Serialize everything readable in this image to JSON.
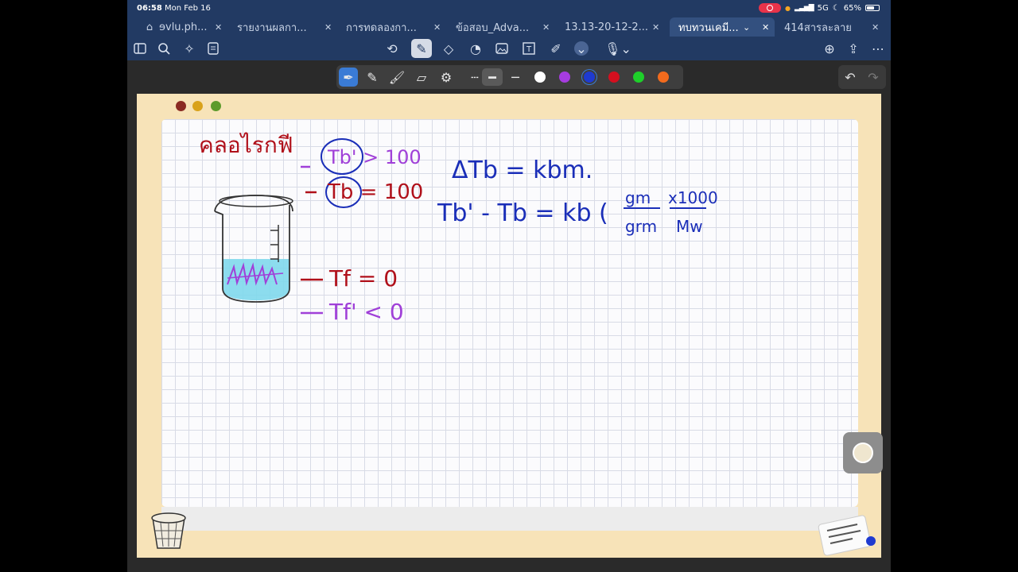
{
  "status_bar": {
    "time": "06:58",
    "date": "Mon Feb 16",
    "network": "5G",
    "battery": "65%"
  },
  "tabs": [
    {
      "label": "ɘvlu.ph...",
      "active": false
    },
    {
      "label": "รายงานผลกา...",
      "active": false
    },
    {
      "label": "การทดลองกา...",
      "active": false
    },
    {
      "label": "ข้อสอบ_Adva...",
      "active": false
    },
    {
      "label": "13.13-20-12-2...",
      "active": false
    },
    {
      "label": "ทบทวนเคมี...",
      "active": true
    },
    {
      "label": "414สารละลาย",
      "active": false
    }
  ],
  "note": {
    "heading": "คลอไรกฟี",
    "tb_greater": "Tb' > 100",
    "tb_equal": "Tb = 100",
    "tf_equal": "Tf = 0",
    "tf_less": "Tf' < 0",
    "eq1": "ΔTb = kbm.",
    "eq2_left": "Tb' - Tb = kb (",
    "frac1_num": "gm",
    "frac1_den": "grm",
    "frac2_num": "x1000",
    "frac2_den": "Mw"
  },
  "colors": {
    "topbar": "#223a63",
    "paper": "#f7e3b8",
    "ink_red": "#b0101a",
    "ink_purple": "#a040d8",
    "ink_blue": "#1a2eb8",
    "water": "#7fd8ec",
    "swatches": [
      "#ffffff",
      "#a63ce0",
      "#1e3ad0",
      "#d40f1f",
      "#1ecf2a",
      "#f26b1d"
    ]
  }
}
